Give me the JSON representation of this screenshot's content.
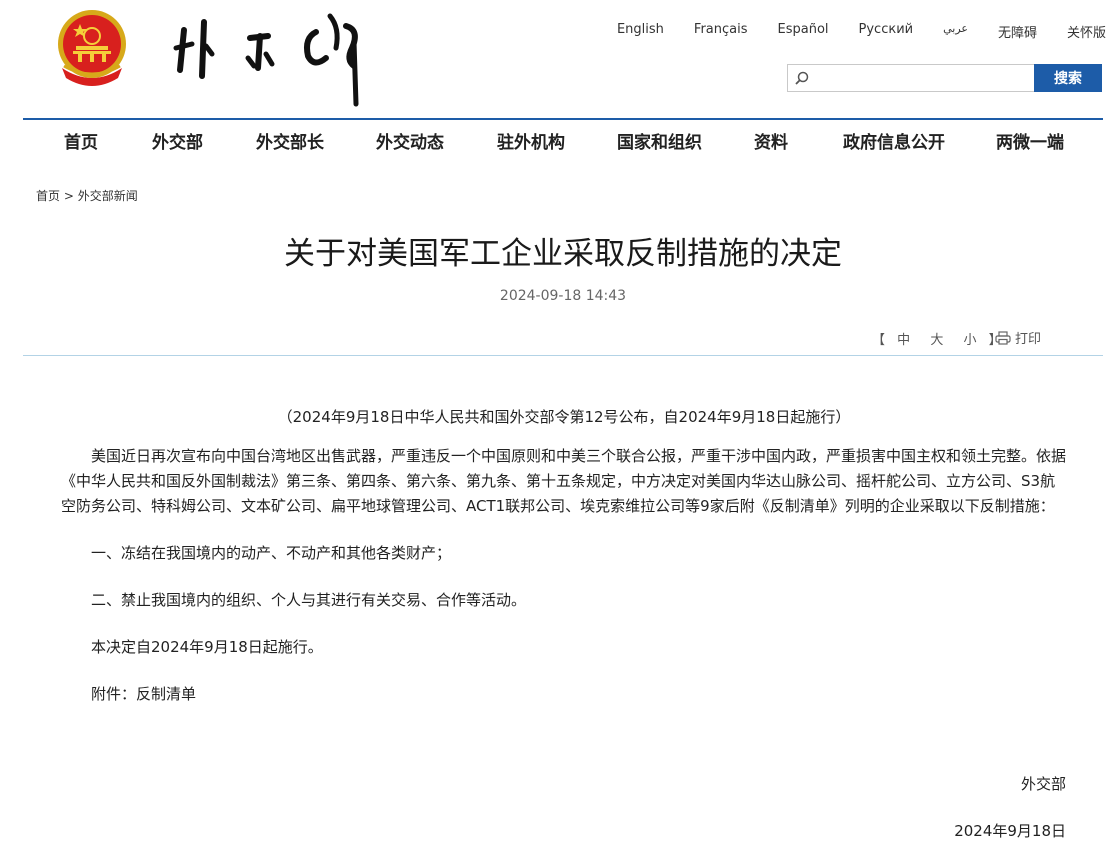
{
  "header": {
    "languages": [
      "English",
      "Français",
      "Español",
      "Русский",
      "عربي",
      "无障碍",
      "关怀版"
    ],
    "search": {
      "placeholder": "",
      "button_label": "搜索"
    }
  },
  "nav": {
    "items": [
      "首页",
      "外交部",
      "外交部长",
      "外交动态",
      "驻外机构",
      "国家和组织",
      "资料",
      "政府信息公开",
      "两微一端"
    ]
  },
  "breadcrumb": {
    "home": "首页",
    "separator": ">",
    "current": "外交部新闻"
  },
  "article": {
    "title": "关于对美国军工企业采取反制措施的决定",
    "datetime": "2024-09-18 14:43",
    "font_tools": {
      "open_bracket": "【",
      "large": "中",
      "medium": "大",
      "small": "小",
      "close_bracket": "】"
    },
    "print_label": "打印",
    "notice": "（2024年9月18日中华人民共和国外交部令第12号公布，自2024年9月18日起施行）",
    "paragraphs": [
      "美国近日再次宣布向中国台湾地区出售武器，严重违反一个中国原则和中美三个联合公报，严重干涉中国内政，严重损害中国主权和领土完整。依据《中华人民共和国反外国制裁法》第三条、第四条、第六条、第九条、第十五条规定，中方决定对美国内华达山脉公司、摇杆舵公司、立方公司、S3航空防务公司、特科姆公司、文本矿公司、扁平地球管理公司、ACT1联邦公司、埃克索维拉公司等9家后附《反制清单》列明的企业采取以下反制措施：",
      "一、冻结在我国境内的动产、不动产和其他各类财产；",
      "二、禁止我国境内的组织、个人与其进行有关交易、合作等活动。",
      "本决定自2024年9月18日起施行。"
    ],
    "attachment_label": "附件：",
    "attachment_link": "反制清单",
    "signature_org": "外交部",
    "signature_date": "2024年9月18日"
  },
  "colors": {
    "accent": "#1d5ca8",
    "divider": "#b3d3e6"
  }
}
